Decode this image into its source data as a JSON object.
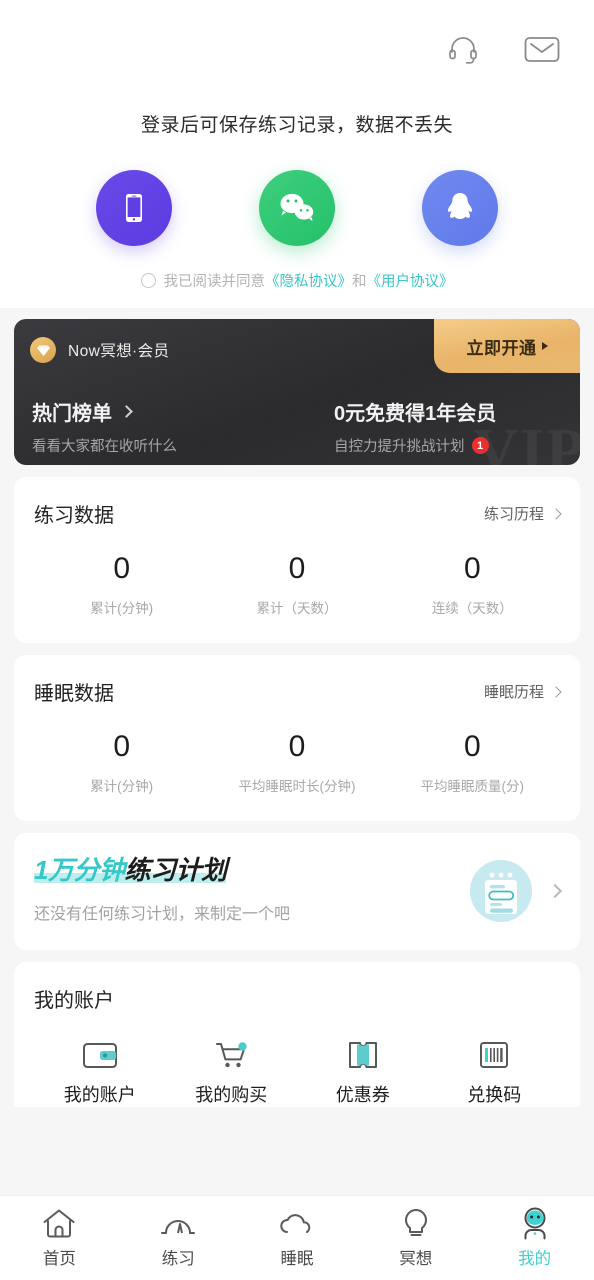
{
  "header": {
    "icons": [
      {
        "name": "headset-icon",
        "label": "客服"
      },
      {
        "name": "mail-icon",
        "label": "消息"
      }
    ]
  },
  "login": {
    "tip": "登录后可保存练习记录，数据不丢失",
    "methods": [
      {
        "id": "phone",
        "label": "手机号登录",
        "color": "#5f3fe3"
      },
      {
        "id": "wechat",
        "label": "微信登录",
        "color": "#2ec268"
      },
      {
        "id": "qq",
        "label": "QQ登录",
        "color": "#6a82ec"
      }
    ],
    "agreement": {
      "checked": false,
      "prefix": "我已阅读并同意",
      "privacy": "《隐私协议》",
      "conj": "和",
      "terms": "《用户协议》",
      "link_color": "#3ac6c6"
    }
  },
  "vip": {
    "brand": "Now冥想·会员",
    "cta": "立即开通",
    "watermark": "VIP",
    "left": {
      "title": "热门榜单",
      "subtitle": "看看大家都在收听什么"
    },
    "right": {
      "title": "0元免费得1年会员",
      "subtitle": "自控力提升挑战计划",
      "badge": "1"
    }
  },
  "practice_card": {
    "title": "练习数据",
    "link": "练习历程",
    "stats": [
      {
        "value": "0",
        "label": "累计(分钟)"
      },
      {
        "value": "0",
        "label": "累计（天数）"
      },
      {
        "value": "0",
        "label": "连续（天数）"
      }
    ]
  },
  "sleep_card": {
    "title": "睡眠数据",
    "link": "睡眠历程",
    "stats": [
      {
        "value": "0",
        "label": "累计(分钟)"
      },
      {
        "value": "0",
        "label": "平均睡眠时长(分钟)"
      },
      {
        "value": "0",
        "label": "平均睡眠质量(分)"
      }
    ]
  },
  "plan_card": {
    "title_highlight": "1万分钟",
    "title_rest": "练习计划",
    "subtitle": "还没有任何练习计划，来制定一个吧",
    "highlight_color": "#35c8c8",
    "underline_color": "#bdeeee"
  },
  "account_card": {
    "title": "我的账户",
    "items": [
      {
        "icon": "wallet-icon",
        "label": "我的账户"
      },
      {
        "icon": "cart-icon",
        "label": "我的购买"
      },
      {
        "icon": "coupon-icon",
        "label": "优惠券"
      },
      {
        "icon": "barcode-icon",
        "label": "兑换码"
      }
    ]
  },
  "tabbar": {
    "active_index": 4,
    "active_color": "#3fd0cf",
    "items": [
      {
        "icon": "home-icon",
        "label": "首页"
      },
      {
        "icon": "gauge-icon",
        "label": "练习"
      },
      {
        "icon": "cloud-icon",
        "label": "睡眠"
      },
      {
        "icon": "bulb-icon",
        "label": "冥想"
      },
      {
        "icon": "profile-icon",
        "label": "我的"
      }
    ]
  }
}
